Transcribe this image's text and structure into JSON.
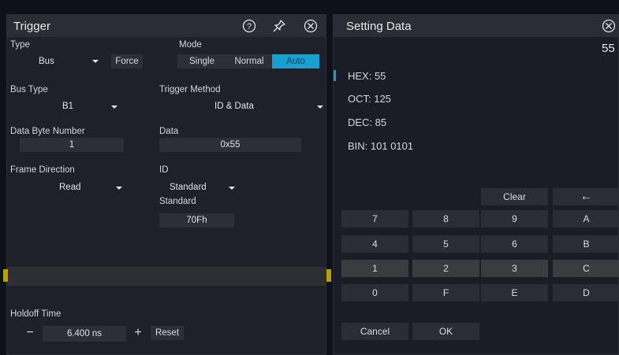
{
  "trigger": {
    "title": "Trigger",
    "type_label": "Type",
    "type_value": "Bus",
    "force_label": "Force",
    "mode_label": "Mode",
    "mode_options": [
      "Single",
      "Normal",
      "Auto"
    ],
    "bus_type_label": "Bus Type",
    "bus_type_value": "B1",
    "trigger_method_label": "Trigger Method",
    "trigger_method_value": "ID & Data",
    "data_byte_number_label": "Data Byte Number",
    "data_byte_number_value": "1",
    "data_label": "Data",
    "data_value": "0x55",
    "frame_direction_label": "Frame Direction",
    "frame_direction_value": "Read",
    "id_label": "ID",
    "id_value": "Standard",
    "standard_label": "Standard",
    "standard_value": "70Fh",
    "holdoff_label": "Holdoff Time",
    "holdoff_minus": "−",
    "holdoff_value": "6.400 ns",
    "holdoff_plus": "+",
    "reset_label": "Reset",
    "accent_color": "#1aa0d0"
  },
  "setting": {
    "title": "Setting Data",
    "display_value": "55",
    "hex": "HEX: 55",
    "oct": "OCT: 125",
    "dec": "DEC: 85",
    "bin": "BIN: 101 0101",
    "clear_label": "Clear",
    "backspace_label": "←",
    "keys": [
      [
        "7",
        "8",
        "9",
        "A"
      ],
      [
        "4",
        "5",
        "6",
        "B"
      ],
      [
        "1",
        "2",
        "3",
        "C"
      ],
      [
        "0",
        "F",
        "E",
        "D"
      ]
    ],
    "cancel_label": "Cancel",
    "ok_label": "OK"
  }
}
